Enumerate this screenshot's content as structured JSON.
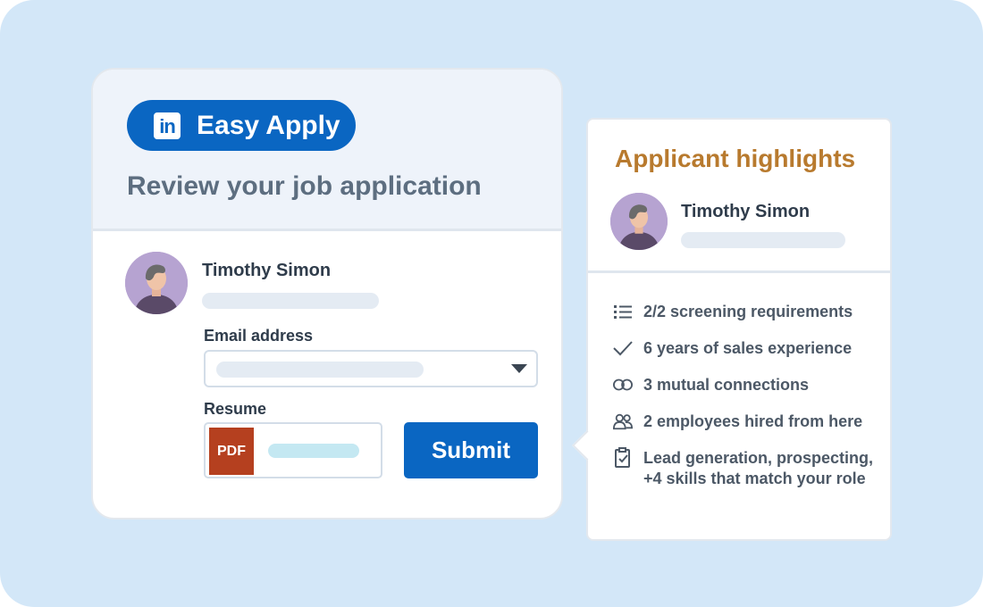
{
  "apply_card": {
    "badge_label": "Easy Apply",
    "logo_text": "in",
    "title": "Review your job application",
    "applicant_name": "Timothy Simon",
    "email_label": "Email address",
    "resume_label": "Resume",
    "resume_file_type": "PDF",
    "submit_label": "Submit"
  },
  "highlights_card": {
    "title": "Applicant highlights",
    "applicant_name": "Timothy Simon",
    "items": [
      {
        "icon": "list-icon",
        "text": "2/2 screening requirements"
      },
      {
        "icon": "checkmark-icon",
        "text": "6 years of sales experience"
      },
      {
        "icon": "connections-icon",
        "text": "3 mutual connections"
      },
      {
        "icon": "people-icon",
        "text": "2 employees hired from here"
      },
      {
        "icon": "clipboard-check-icon",
        "text": "Lead generation, prospecting, +4 skills that match your role"
      }
    ]
  },
  "colors": {
    "background": "#d3e7f8",
    "linkedin_blue": "#0a66c2",
    "highlight_title": "#b87a2e",
    "pdf_red": "#b5401f"
  }
}
